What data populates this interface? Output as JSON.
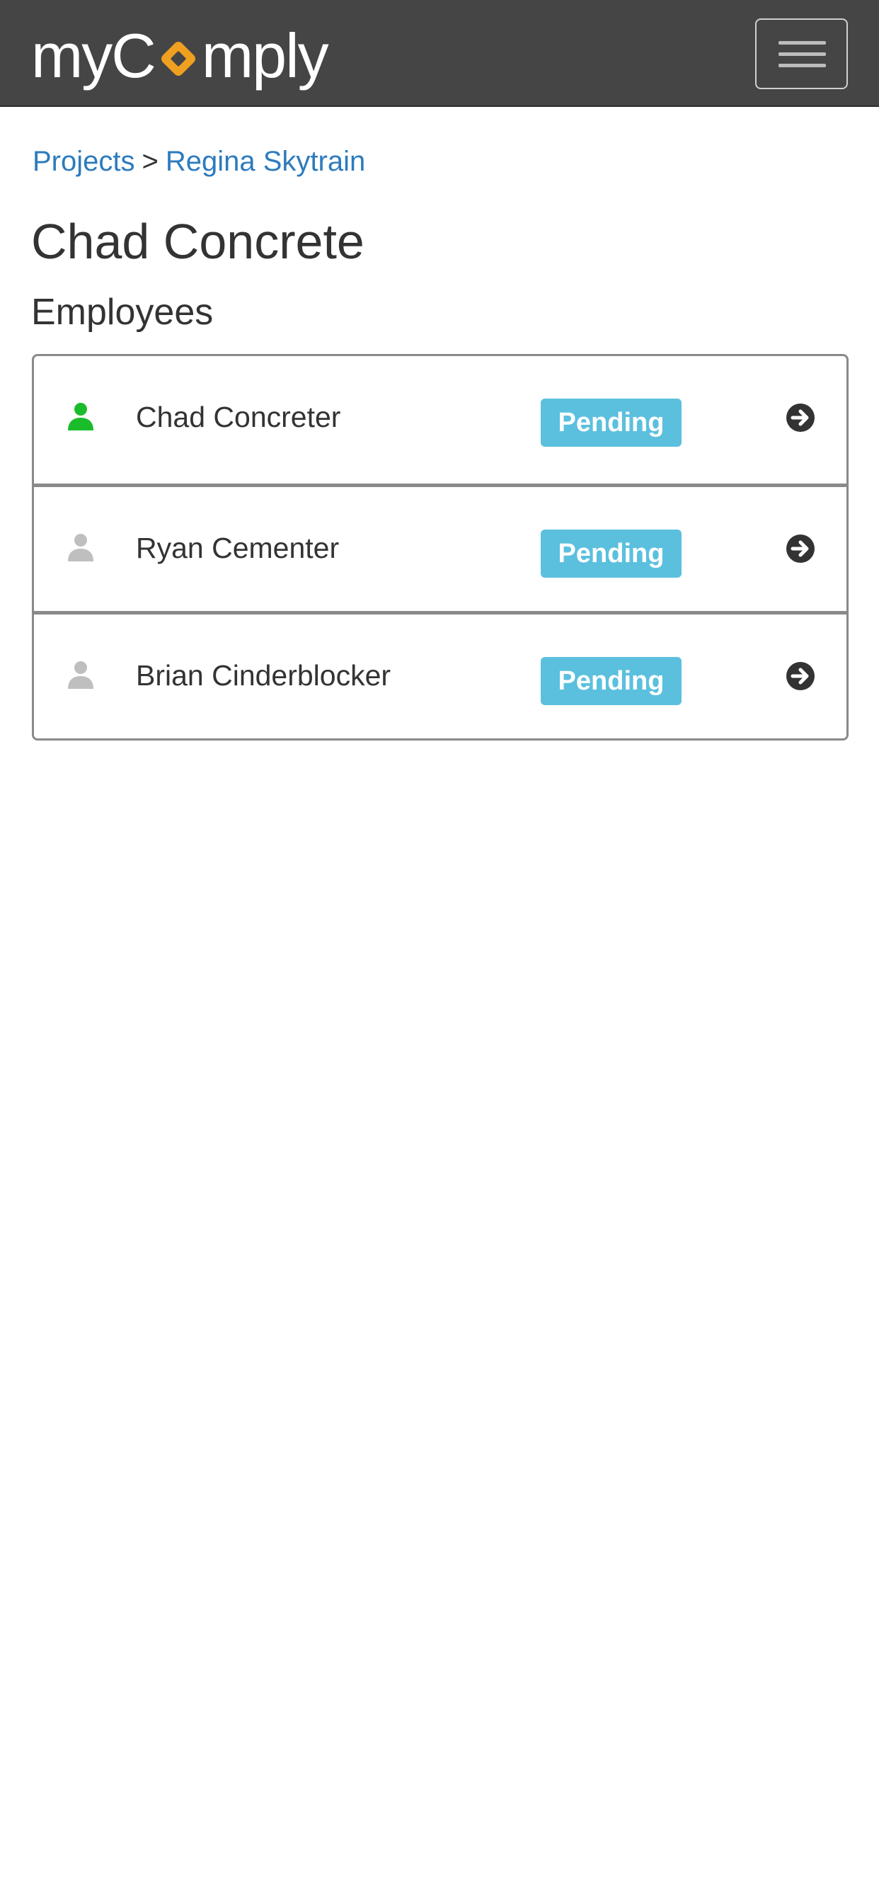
{
  "header": {
    "logo": {
      "text_before": "myC",
      "text_after": "mply",
      "full_name": "myComply",
      "accent_color": "#f0a020"
    },
    "menu_icon": "hamburger-menu-icon"
  },
  "breadcrumb": {
    "items": [
      {
        "label": "Projects"
      },
      {
        "label": "Regina Skytrain"
      }
    ],
    "separator": ">"
  },
  "page": {
    "title": "Chad Concrete",
    "section_title": "Employees"
  },
  "employees": [
    {
      "name": "Chad Concreter",
      "status": "Pending",
      "icon": "person-icon",
      "icon_color": "#1bbc2b",
      "action_icon": "arrow-circle-right-icon"
    },
    {
      "name": "Ryan Cementer",
      "status": "Pending",
      "icon": "person-icon",
      "icon_color": "#bfbfbf",
      "action_icon": "arrow-circle-right-icon"
    },
    {
      "name": "Brian Cinderblocker",
      "status": "Pending",
      "icon": "person-icon",
      "icon_color": "#bfbfbf",
      "action_icon": "arrow-circle-right-icon"
    }
  ],
  "colors": {
    "navbar_bg": "#454545",
    "link": "#2d7bbd",
    "status_pending": "#5bc0de",
    "text": "#333333"
  }
}
